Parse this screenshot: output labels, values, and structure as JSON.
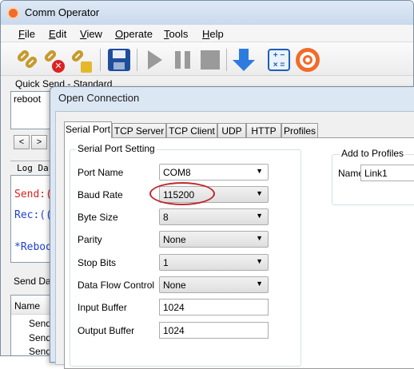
{
  "window": {
    "title": "Comm Operator"
  },
  "menu": [
    "File",
    "Edit",
    "View",
    "Operate",
    "Tools",
    "Help"
  ],
  "menu_underline": [
    "F",
    "E",
    "V",
    "O",
    "T",
    "H"
  ],
  "menu_rest": [
    "ile",
    "dit",
    "iew",
    "perate",
    "ools",
    "elp"
  ],
  "toolbar": {
    "buttons": [
      "open-connection",
      "close-connection",
      "connection-settings",
      "save",
      "play",
      "pause",
      "stop",
      "download",
      "calculator",
      "about"
    ]
  },
  "quick_send": {
    "label": "Quick Send - Standard",
    "text": "reboot",
    "nav_prev": "<",
    "nav_next": ">"
  },
  "log": {
    "label": "Log Da",
    "lines": [
      "Send:(",
      "Rec:((",
      "*Reboo"
    ],
    "colors": {
      "send": "#e02020",
      "rec": "#1f3fd0",
      "note": "#1f3fd0"
    }
  },
  "send_data": {
    "label": "Send Dat",
    "column": "Name",
    "rows": [
      "Send(",
      "Send(",
      "Send("
    ]
  },
  "dialog": {
    "title": "Open Connection",
    "tabs": [
      "Serial Port",
      "TCP Server",
      "TCP Client",
      "UDP",
      "HTTP",
      "Profiles"
    ],
    "group": "Serial Port Setting",
    "fields": [
      {
        "label": "Port Name",
        "value": "COM8"
      },
      {
        "label": "Baud Rate",
        "value": "115200"
      },
      {
        "label": "Byte Size",
        "value": "8"
      },
      {
        "label": "Parity",
        "value": "None"
      },
      {
        "label": "Stop Bits",
        "value": "1"
      },
      {
        "label": "Data Flow Control",
        "value": "None"
      },
      {
        "label": "Input Buffer",
        "value": "1024"
      },
      {
        "label": "Output Buffer",
        "value": "1024"
      }
    ],
    "profiles": {
      "group": "Add to Profiles",
      "name_label": "Name",
      "name_value": "Link1"
    },
    "highlight_color": "#c0282d"
  }
}
